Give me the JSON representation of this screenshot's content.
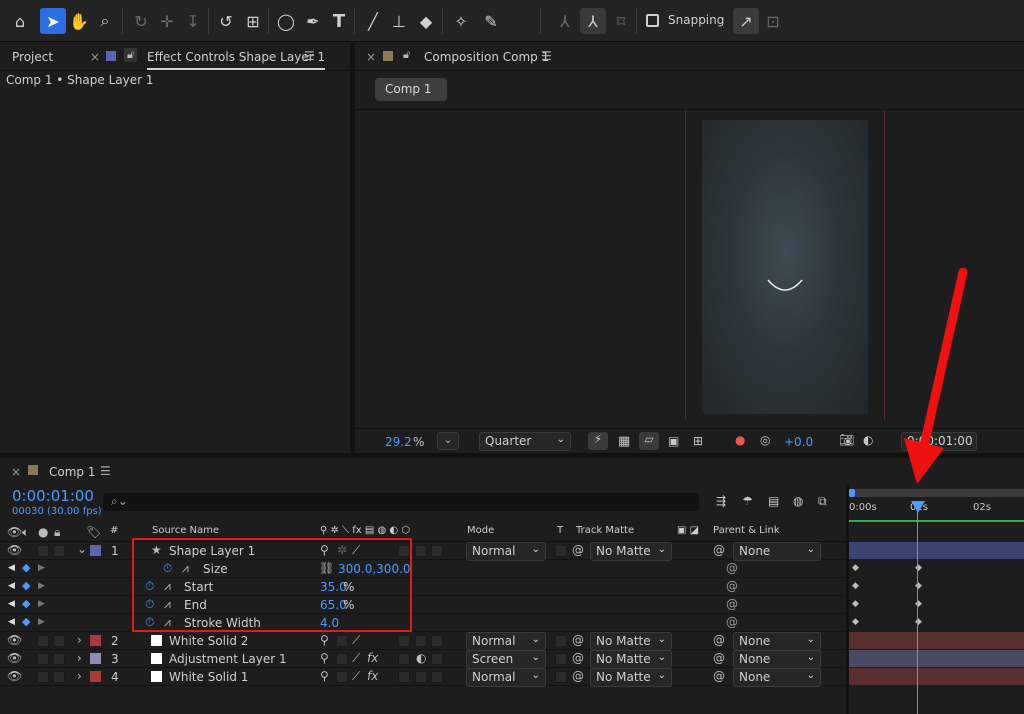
{
  "toolbar": {
    "snapping_label": "Snapping",
    "icons": [
      "home-icon",
      "selection-icon",
      "hand-icon",
      "zoom-icon",
      "orbit-icon",
      "pan-icon",
      "dolly-icon",
      "rotate-icon",
      "anchor-icon",
      "ellipse-icon",
      "pen-icon",
      "type-icon",
      "brush-icon",
      "clone-stamp-icon",
      "eraser-icon",
      "roto-brush-icon",
      "puppet-pin-icon"
    ]
  },
  "left_panel": {
    "tab_project": "Project",
    "tab_effect_controls": "Effect Controls Shape Layer 1",
    "breadcrumb": "Comp 1 • Shape Layer 1"
  },
  "comp_panel": {
    "tab_label": "Composition Comp 1",
    "comp_button": "Comp 1",
    "zoom_value": "29.2",
    "zoom_unit": "%",
    "resolution": "Quarter",
    "exposure": "+0.0",
    "timecode": "0:00:01:00"
  },
  "timeline": {
    "tab_label": "Comp 1",
    "current_time": "0:00:01:00",
    "frame_info": "00030 (30.00 fps)",
    "search_placeholder": "",
    "headers": {
      "number": "#",
      "source_name": "Source Name",
      "mode": "Mode",
      "t": "T",
      "track_matte": "Track Matte",
      "parent_link": "Parent & Link"
    },
    "ruler": [
      "0:00s",
      "01s",
      "02s"
    ],
    "layers": [
      {
        "num": "1",
        "name": "Shape Layer 1",
        "mode": "Normal",
        "matte": "No Matte",
        "parent": "None",
        "color": "#5b63b3"
      },
      {
        "num": "2",
        "name": "White Solid 2",
        "mode": "Normal",
        "matte": "No Matte",
        "parent": "None",
        "color": "#a83a3a"
      },
      {
        "num": "3",
        "name": "Adjustment Layer 1",
        "mode": "Screen",
        "matte": "No Matte",
        "parent": "None",
        "color": "#8f8fb0"
      },
      {
        "num": "4",
        "name": "White Solid 1",
        "mode": "Normal",
        "matte": "No Matte",
        "parent": "None",
        "color": "#a83a3a"
      }
    ],
    "properties": [
      {
        "name": "Size",
        "value": "300.0,300.0",
        "unit": ""
      },
      {
        "name": "Start",
        "value": "35.0",
        "unit": "%"
      },
      {
        "name": "End",
        "value": "65.0",
        "unit": "%"
      },
      {
        "name": "Stroke Width",
        "value": "4.0",
        "unit": ""
      }
    ]
  },
  "colors": {
    "accent_blue": "#4a9bff",
    "highlight_red": "#e01b1b",
    "shape_bar": "#3b4470",
    "solid_bar": "#5a2f2f",
    "adj_bar": "#4a4a60"
  }
}
